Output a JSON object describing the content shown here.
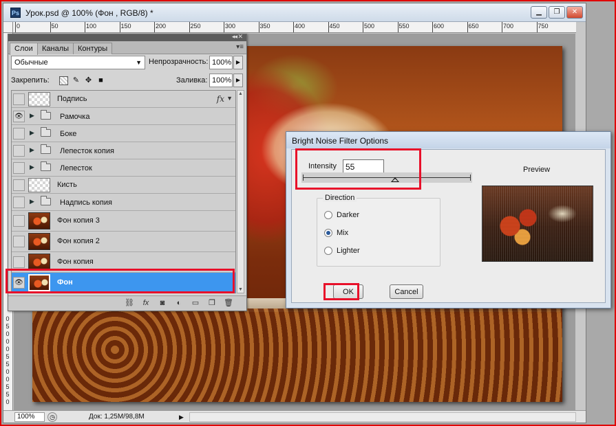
{
  "document": {
    "title": "Урок.psd @ 100% (Фон , RGB/8) *",
    "app_icon": "Ps",
    "window_controls": {
      "minimize": "▁",
      "restore": "❐",
      "close": "✕"
    },
    "ruler_h_labels": [
      "0",
      "50",
      "100",
      "150",
      "200",
      "250",
      "300",
      "350",
      "400",
      "450",
      "500",
      "550",
      "600",
      "650",
      "700",
      "750"
    ],
    "ruler_v_labels": [
      "0",
      "5",
      "0",
      "0",
      "0",
      "5",
      "5",
      "0",
      "0",
      "5",
      "5",
      "0"
    ]
  },
  "status": {
    "zoom": "100%",
    "doc_info": "Док: 1,25M/98,8M"
  },
  "layers_panel": {
    "tabs": [
      {
        "label": "Слои",
        "active": true
      },
      {
        "label": "Каналы",
        "active": false
      },
      {
        "label": "Контуры",
        "active": false
      }
    ],
    "blend_mode": "Обычные",
    "opacity_label": "Непрозрачность:",
    "opacity_value": "100%",
    "lock_label": "Закрепить:",
    "fill_label": "Заливка:",
    "fill_value": "100%",
    "layers": [
      {
        "name": "Подпись",
        "kind": "text",
        "visible": false,
        "fx": true
      },
      {
        "name": "Рамочка",
        "kind": "group",
        "visible": true
      },
      {
        "name": "Боке",
        "kind": "group",
        "visible": false
      },
      {
        "name": "Лепесток копия",
        "kind": "group",
        "visible": false
      },
      {
        "name": "Лепесток",
        "kind": "group",
        "visible": false
      },
      {
        "name": "Кисть",
        "kind": "empty",
        "visible": false
      },
      {
        "name": "Надпись копия",
        "kind": "group",
        "visible": false
      },
      {
        "name": "Фон копия 3",
        "kind": "photo",
        "visible": false
      },
      {
        "name": "Фон  копия 2",
        "kind": "photo",
        "visible": false
      },
      {
        "name": "Фон  копия",
        "kind": "photo",
        "visible": false
      },
      {
        "name": "Фон",
        "kind": "photo",
        "visible": true,
        "selected": true
      }
    ],
    "fx_label": "fx",
    "bottom_icons": [
      "link-icon",
      "fx-icon",
      "mask-icon",
      "adjustment-icon",
      "group-icon",
      "new-layer-icon",
      "trash-icon"
    ]
  },
  "dialog": {
    "title": "Bright Noise Filter Options",
    "intensity_label": "Intensity",
    "intensity_value": "55",
    "intensity_level": 0.55,
    "direction_label": "Direction",
    "options": [
      {
        "label": "Darker",
        "checked": false
      },
      {
        "label": "Mix",
        "checked": true
      },
      {
        "label": "Lighter",
        "checked": false
      }
    ],
    "preview_label": "Preview",
    "ok_label": "OK",
    "cancel_label": "Cancel"
  }
}
